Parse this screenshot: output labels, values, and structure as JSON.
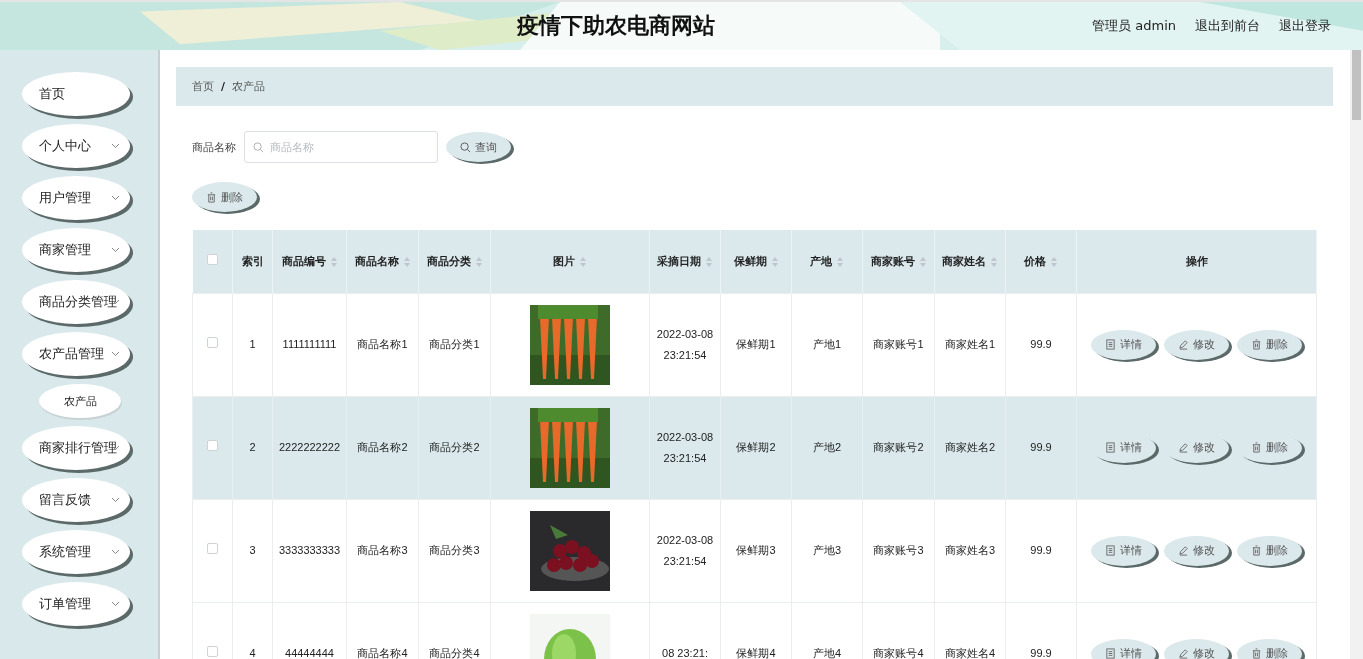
{
  "header": {
    "title": "疫情下助农电商网站",
    "links": [
      "管理员 admin",
      "退出到前台",
      "退出登录"
    ]
  },
  "sidebar": {
    "items": [
      {
        "label": "首页",
        "kind": "link"
      },
      {
        "label": "个人中心",
        "kind": "menu"
      },
      {
        "label": "用户管理",
        "kind": "menu"
      },
      {
        "label": "商家管理",
        "kind": "menu"
      },
      {
        "label": "商品分类管理",
        "kind": "menu"
      },
      {
        "label": "农产品管理",
        "kind": "menu",
        "children": [
          {
            "label": "农产品"
          }
        ]
      },
      {
        "label": "商家排行管理",
        "kind": "menu"
      },
      {
        "label": "留言反馈",
        "kind": "menu"
      },
      {
        "label": "系统管理",
        "kind": "menu"
      },
      {
        "label": "订单管理",
        "kind": "menu"
      }
    ]
  },
  "breadcrumb": [
    "首页",
    "/",
    "农产品"
  ],
  "search": {
    "label": "商品名称",
    "placeholder": "商品名称",
    "button": "查询"
  },
  "delete_button": "删除",
  "table": {
    "select_all_checked": false,
    "columns": [
      {
        "label": "索引",
        "sortable": false
      },
      {
        "label": "商品编号",
        "sortable": true
      },
      {
        "label": "商品名称",
        "sortable": true
      },
      {
        "label": "商品分类",
        "sortable": true
      },
      {
        "label": "图片",
        "sortable": true
      },
      {
        "label": "采摘日期",
        "sortable": true
      },
      {
        "label": "保鲜期",
        "sortable": true
      },
      {
        "label": "产地",
        "sortable": true
      },
      {
        "label": "商家账号",
        "sortable": true
      },
      {
        "label": "商家姓名",
        "sortable": true
      },
      {
        "label": "价格",
        "sortable": true
      },
      {
        "label": "操作",
        "sortable": false
      }
    ],
    "rows": [
      {
        "checked": false,
        "highlighted": false,
        "cells": [
          "1",
          "1111111111",
          "商品名称1",
          "商品分类1",
          {
            "kind": "picture"
          },
          "2022-03-08 23:21:54",
          "保鲜期1",
          "产地1",
          "商家账号1",
          "商家姓名1",
          "99.9"
        ],
        "actions": [
          "详情",
          "修改",
          "删除"
        ]
      },
      {
        "checked": false,
        "highlighted": true,
        "cells": [
          "2",
          "2222222222",
          "商品名称2",
          "商品分类2",
          {
            "kind": "picture"
          },
          "2022-03-08 23:21:54",
          "保鲜期2",
          "产地2",
          "商家账号2",
          "商家姓名2",
          "99.9"
        ],
        "actions": [
          "详情",
          "修改",
          "删除"
        ]
      },
      {
        "checked": false,
        "highlighted": false,
        "cells": [
          "3",
          "3333333333",
          "商品名称3",
          "商品分类3",
          {
            "kind": "picture"
          },
          "2022-03-08 23:21:54",
          "保鲜期3",
          "产地3",
          "商家账号3",
          "商家姓名3",
          "99.9"
        ],
        "actions": [
          "详情",
          "修改",
          "删除"
        ]
      },
      {
        "checked": false,
        "highlighted": false,
        "cells": [
          "4",
          "44444444",
          "商品名称4",
          "商品分类4",
          {
            "kind": "picture"
          },
          "08 23:21:",
          "保鲜期4",
          "产地4",
          "商家账号4",
          "商家姓名4",
          "99.9"
        ],
        "actions": [
          "详情",
          "修改",
          "删除"
        ]
      }
    ]
  }
}
